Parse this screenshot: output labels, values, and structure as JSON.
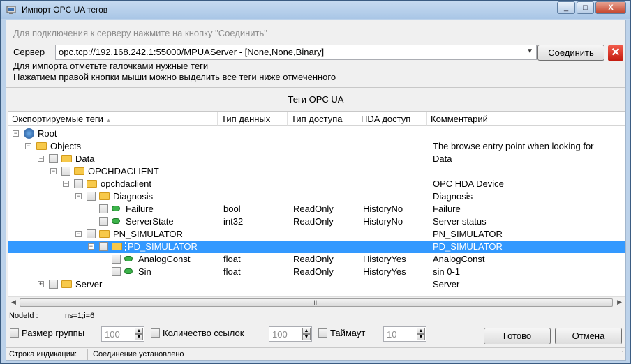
{
  "window": {
    "title": "Импорт OPC UA тегов",
    "controls": [
      "_",
      "□",
      "X"
    ]
  },
  "connect_hint": "Для подключения к серверу нажмите на кнопку \"Соединить\"",
  "server": {
    "label": "Сервер",
    "value": "opc.tcp://192.168.242.1:55000/MPUAServer - [None,None,Binary]",
    "connect_button": "Соединить",
    "close_icon": "close-red-x-icon"
  },
  "notes": {
    "line1": "Для импорта отметьте галочками нужные теги",
    "line2": "Нажатием правой кнопки мыши можно выделить все теги ниже отмеченного"
  },
  "tags_panel_title": "Теги OPC UA",
  "columns": [
    "Экспортируемые теги",
    "Тип данных",
    "Тип доступа",
    "HDA доступ",
    "Комментарий"
  ],
  "tree": [
    {
      "level": 0,
      "expander": "⊟",
      "checkbox": false,
      "icon": "root-icon",
      "name": "Root",
      "type": "",
      "access": "",
      "hda": "",
      "comment": ""
    },
    {
      "level": 1,
      "expander": "⊟",
      "checkbox": false,
      "icon": "folder-icon",
      "name": "Objects",
      "type": "",
      "access": "",
      "hda": "",
      "comment": "The browse entry point when looking for"
    },
    {
      "level": 2,
      "expander": "⊟",
      "checkbox": true,
      "icon": "folder-icon",
      "name": "Data",
      "type": "",
      "access": "",
      "hda": "",
      "comment": "Data"
    },
    {
      "level": 3,
      "expander": "⊟",
      "checkbox": true,
      "icon": "folder-icon",
      "name": "OPCHDACLIENT",
      "type": "",
      "access": "",
      "hda": "",
      "comment": ""
    },
    {
      "level": 4,
      "expander": "⊟",
      "checkbox": true,
      "icon": "folder-icon",
      "name": "opchdaclient",
      "type": "",
      "access": "",
      "hda": "",
      "comment": "OPC HDA Device"
    },
    {
      "level": 5,
      "expander": "⊟",
      "checkbox": true,
      "icon": "folder-icon",
      "name": "Diagnosis",
      "type": "",
      "access": "",
      "hda": "",
      "comment": "Diagnosis"
    },
    {
      "level": 6,
      "expander": "",
      "checkbox": true,
      "icon": "tag-icon",
      "name": "Failure",
      "type": "bool",
      "access": "ReadOnly",
      "hda": "HistoryNo",
      "comment": "Failure"
    },
    {
      "level": 6,
      "expander": "",
      "checkbox": true,
      "icon": "tag-icon",
      "name": "ServerState",
      "type": "int32",
      "access": "ReadOnly",
      "hda": "HistoryNo",
      "comment": "Server status"
    },
    {
      "level": 5,
      "expander": "⊟",
      "checkbox": true,
      "icon": "folder-icon",
      "name": "PN_SIMULATOR",
      "type": "",
      "access": "",
      "hda": "",
      "comment": "PN_SIMULATOR"
    },
    {
      "level": 6,
      "expander": "⊟",
      "checkbox": true,
      "icon": "folder-icon",
      "name": "PD_SIMULATOR",
      "type": "",
      "access": "",
      "hda": "",
      "comment": "PD_SIMULATOR",
      "selected": true
    },
    {
      "level": 7,
      "expander": "",
      "checkbox": true,
      "icon": "tag-icon",
      "name": "AnalogConst",
      "type": "float",
      "access": "ReadOnly",
      "hda": "HistoryYes",
      "comment": "AnalogConst"
    },
    {
      "level": 7,
      "expander": "",
      "checkbox": true,
      "icon": "tag-icon",
      "name": "Sin",
      "type": "float",
      "access": "ReadOnly",
      "hda": "HistoryYes",
      "comment": "sin 0-1"
    },
    {
      "level": 2,
      "expander": "⊞",
      "checkbox": true,
      "icon": "folder-icon",
      "name": "Server",
      "type": "",
      "access": "",
      "hda": "",
      "comment": "Server"
    }
  ],
  "scroll_grip": "III",
  "node_id": {
    "label": "NodeId :",
    "value": "ns=1;i=6"
  },
  "options": {
    "group_size": {
      "label": "Размер группы",
      "value": "100"
    },
    "link_count": {
      "label": "Количество ссылок",
      "value": "100"
    },
    "timeout": {
      "label": "Таймаут",
      "value": "10"
    }
  },
  "buttons": {
    "ok": "Готово",
    "cancel": "Отмена"
  },
  "status": {
    "label": "Строка индикации:",
    "value": "Соединение установлено"
  },
  "colors": {
    "selection": "#3399ff",
    "folder": "#f7c94a",
    "tag": "#3cb34a",
    "close": "#d32a1c"
  }
}
